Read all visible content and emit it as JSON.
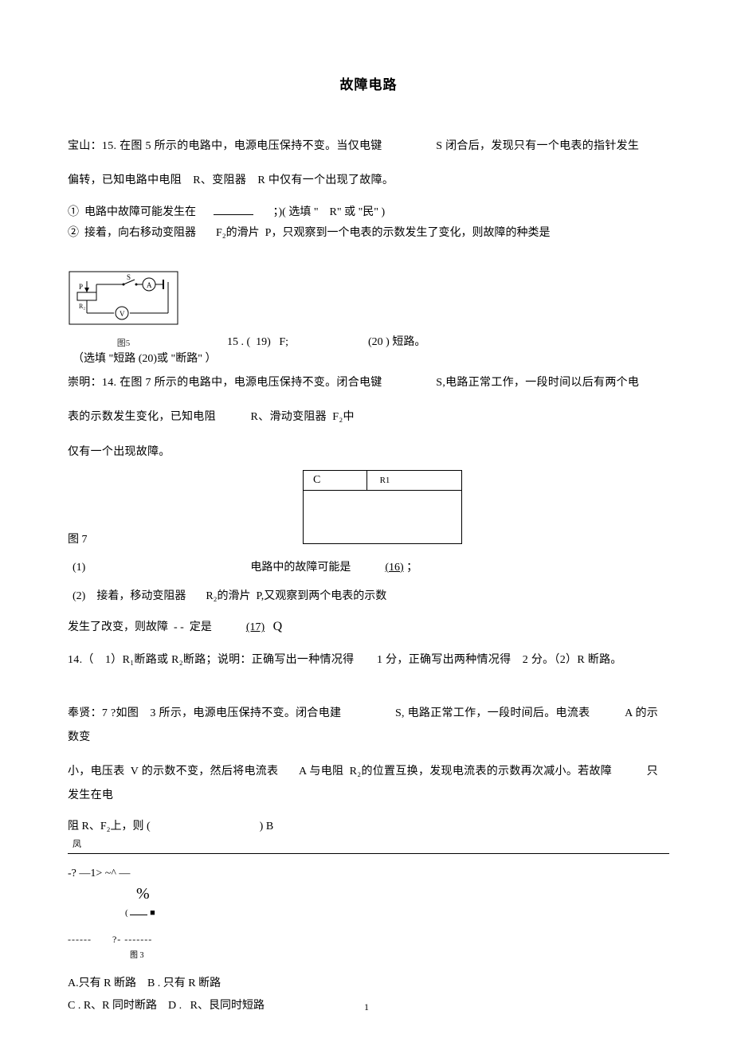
{
  "title": "故障电路",
  "baoshan": {
    "lead": "宝山：15. 在图 5 所示的电路中，电源电压保持不变。当仅电键",
    "lead_s": "S 闭合后，发现只有一个电表的指针发生",
    "lead2": "偏转，已知电路中电阻 R、变阻器 R 中仅有一个出现了故障。",
    "item1_a": "① 电路中故障可能发生在",
    "item1_b": "；)( 选填 \" R\" 或 \"民\" )",
    "item2_a": "② 接着，向右移动变阻器",
    "item2_b": "F₂的滑片 P，只观察到一个电表的示数发生了变化，则故障的种类是",
    "fig_cap": "图5",
    "ans_a": "15 . ( 19)  F;",
    "ans_b": "(20 ) 短路。",
    "ans_note": "（选填 \"短路 (20)或 \"断路\" ）"
  },
  "chongming": {
    "lead_a": "崇明：14. 在图 7 所示的电路中，电源电压保持不变。闭合电键",
    "lead_s": "S,电路正常工作，一段时间以后有两个电",
    "line2_a": "表的示数发生变化，已知电阻",
    "line2_b": "R、滑动变阻器 F₂中",
    "line3": "仅有一个出现故障。",
    "box_c": "C",
    "box_r1": "R1",
    "fig7": "图 7",
    "q1_a": "(1)",
    "q1_b": "电路中的故障可能是",
    "q1_blank": "(16)",
    "q1_semicolon": "；",
    "q2_a": "(2) 接着，移动变阻器",
    "q2_b": "R₂的滑片 P,又观察到两个电表的示数",
    "q3_a": "发生了改变，则故障 - - 定是",
    "q3_blank": "(17)",
    "q3_q": "Q",
    "ans": "14.（ 1）R₁断路或 R₂断路；说明：正确写出一种情况得  1 分，正确写出两种情况得 2 分。（2）R 断路。"
  },
  "fengxian": {
    "lead_a": "奉贤：7 ?如图 3 所示，电源电压保持不变。闭合电建",
    "lead_s": "S, 电路正常工作，一段时间后。电流表",
    "lead_a2": "A 的示数变",
    "line2_a": "小，电压表 V 的示数不变，然后将电流表",
    "line2_b": "A 与电阻 R₂的位置互换，发现电流表的示数再次减小。若故障",
    "line2_c": "只发生在电",
    "line3": "阻 R、F₂上，则 (",
    "line3_b": ") B",
    "ri": "凤",
    "draw1": "-? —1> ~^ —",
    "draw_pct": "%",
    "draw_paren": "( ___ ■",
    "draw_dash": "------  ?- -------",
    "fig3": "图 3",
    "opt_a": "A.只有 R 断路 B . 只有 R 断路",
    "opt_c": "C . R、R 同时断路 D .  R、艮同时短路"
  },
  "page_num": "1"
}
